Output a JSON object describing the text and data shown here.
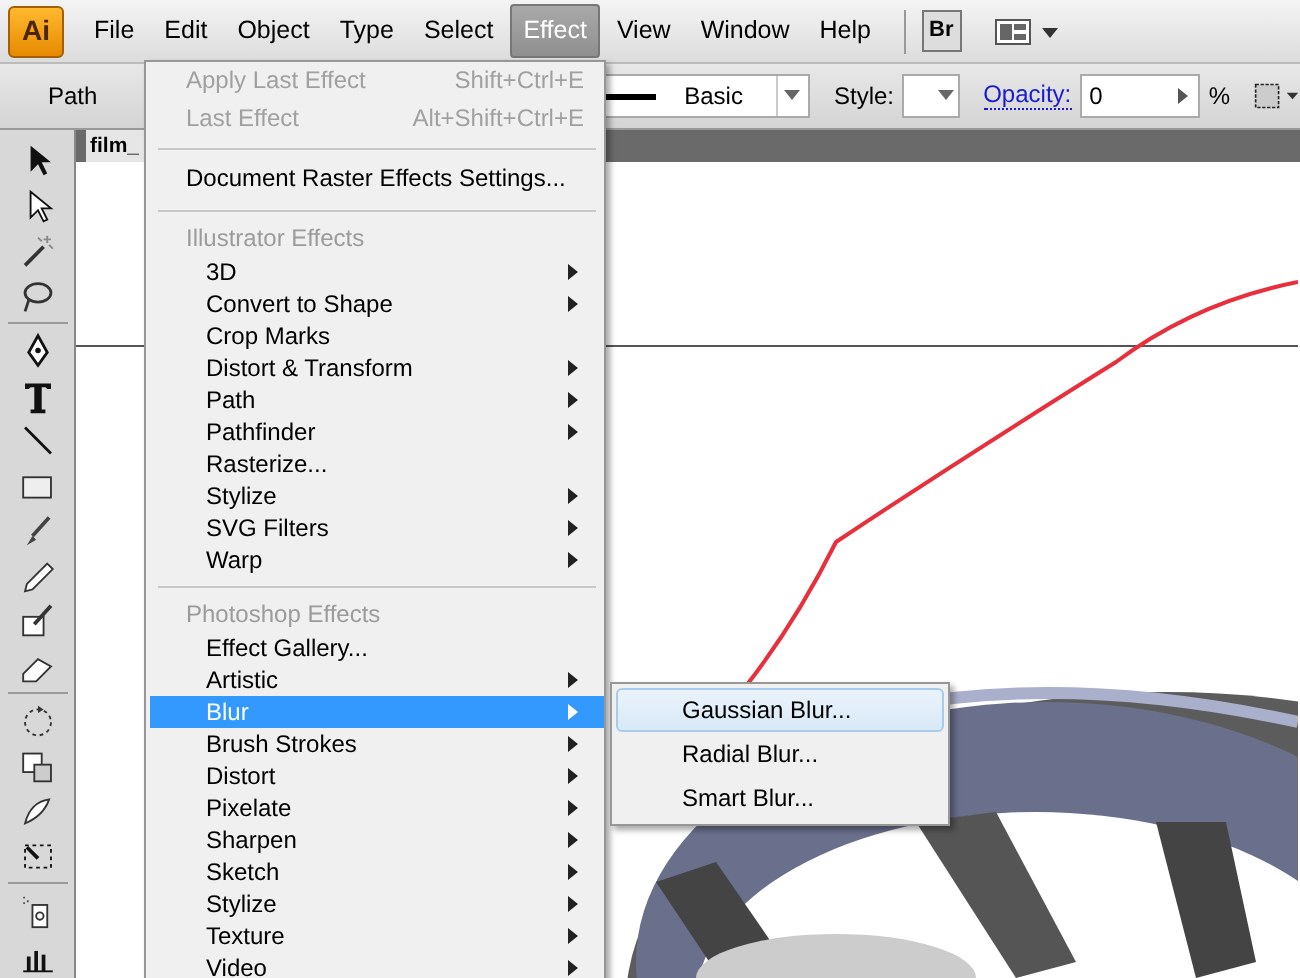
{
  "menubar": {
    "app_logo": "Ai",
    "items": [
      {
        "label": "File",
        "selected": false
      },
      {
        "label": "Edit",
        "selected": false
      },
      {
        "label": "Object",
        "selected": false
      },
      {
        "label": "Type",
        "selected": false
      },
      {
        "label": "Select",
        "selected": false
      },
      {
        "label": "Effect",
        "selected": true
      },
      {
        "label": "View",
        "selected": false
      },
      {
        "label": "Window",
        "selected": false
      },
      {
        "label": "Help",
        "selected": false
      }
    ],
    "bridge_button": "Br"
  },
  "options_bar": {
    "label": "Path",
    "stroke_profile": "Basic",
    "style_label": "Style:",
    "opacity_label": "Opacity:",
    "opacity_value": "0",
    "percent": "%"
  },
  "document_tab": "film_",
  "effect_menu": {
    "sections": [
      {
        "items": [
          {
            "label": "Apply Last Effect",
            "shortcut": "Shift+Ctrl+E",
            "disabled": true,
            "submenu": false,
            "selected": false
          },
          {
            "label": "Last Effect",
            "shortcut": "Alt+Shift+Ctrl+E",
            "disabled": true,
            "submenu": false,
            "selected": false
          }
        ]
      },
      {
        "items": [
          {
            "label": "Document Raster Effects Settings...",
            "disabled": false,
            "submenu": false,
            "selected": false
          }
        ]
      },
      {
        "header": "Illustrator Effects",
        "items": [
          {
            "label": "3D",
            "disabled": false,
            "submenu": true,
            "selected": false
          },
          {
            "label": "Convert to Shape",
            "disabled": false,
            "submenu": true,
            "selected": false
          },
          {
            "label": "Crop Marks",
            "disabled": false,
            "submenu": false,
            "selected": false
          },
          {
            "label": "Distort & Transform",
            "disabled": false,
            "submenu": true,
            "selected": false
          },
          {
            "label": "Path",
            "disabled": false,
            "submenu": true,
            "selected": false
          },
          {
            "label": "Pathfinder",
            "disabled": false,
            "submenu": true,
            "selected": false
          },
          {
            "label": "Rasterize...",
            "disabled": false,
            "submenu": false,
            "selected": false
          },
          {
            "label": "Stylize",
            "disabled": false,
            "submenu": true,
            "selected": false
          },
          {
            "label": "SVG Filters",
            "disabled": false,
            "submenu": true,
            "selected": false
          },
          {
            "label": "Warp",
            "disabled": false,
            "submenu": true,
            "selected": false
          }
        ]
      },
      {
        "header": "Photoshop Effects",
        "items": [
          {
            "label": "Effect Gallery...",
            "disabled": false,
            "submenu": false,
            "selected": false
          },
          {
            "label": "Artistic",
            "disabled": false,
            "submenu": true,
            "selected": false
          },
          {
            "label": "Blur",
            "disabled": false,
            "submenu": true,
            "selected": true
          },
          {
            "label": "Brush Strokes",
            "disabled": false,
            "submenu": true,
            "selected": false
          },
          {
            "label": "Distort",
            "disabled": false,
            "submenu": true,
            "selected": false
          },
          {
            "label": "Pixelate",
            "disabled": false,
            "submenu": true,
            "selected": false
          },
          {
            "label": "Sharpen",
            "disabled": false,
            "submenu": true,
            "selected": false
          },
          {
            "label": "Sketch",
            "disabled": false,
            "submenu": true,
            "selected": false
          },
          {
            "label": "Stylize",
            "disabled": false,
            "submenu": true,
            "selected": false
          },
          {
            "label": "Texture",
            "disabled": false,
            "submenu": true,
            "selected": false
          },
          {
            "label": "Video",
            "disabled": false,
            "submenu": true,
            "selected": false
          }
        ]
      }
    ]
  },
  "blur_submenu": {
    "items": [
      {
        "label": "Gaussian Blur...",
        "selected": true
      },
      {
        "label": "Radial Blur...",
        "selected": false
      },
      {
        "label": "Smart Blur...",
        "selected": false
      }
    ]
  }
}
